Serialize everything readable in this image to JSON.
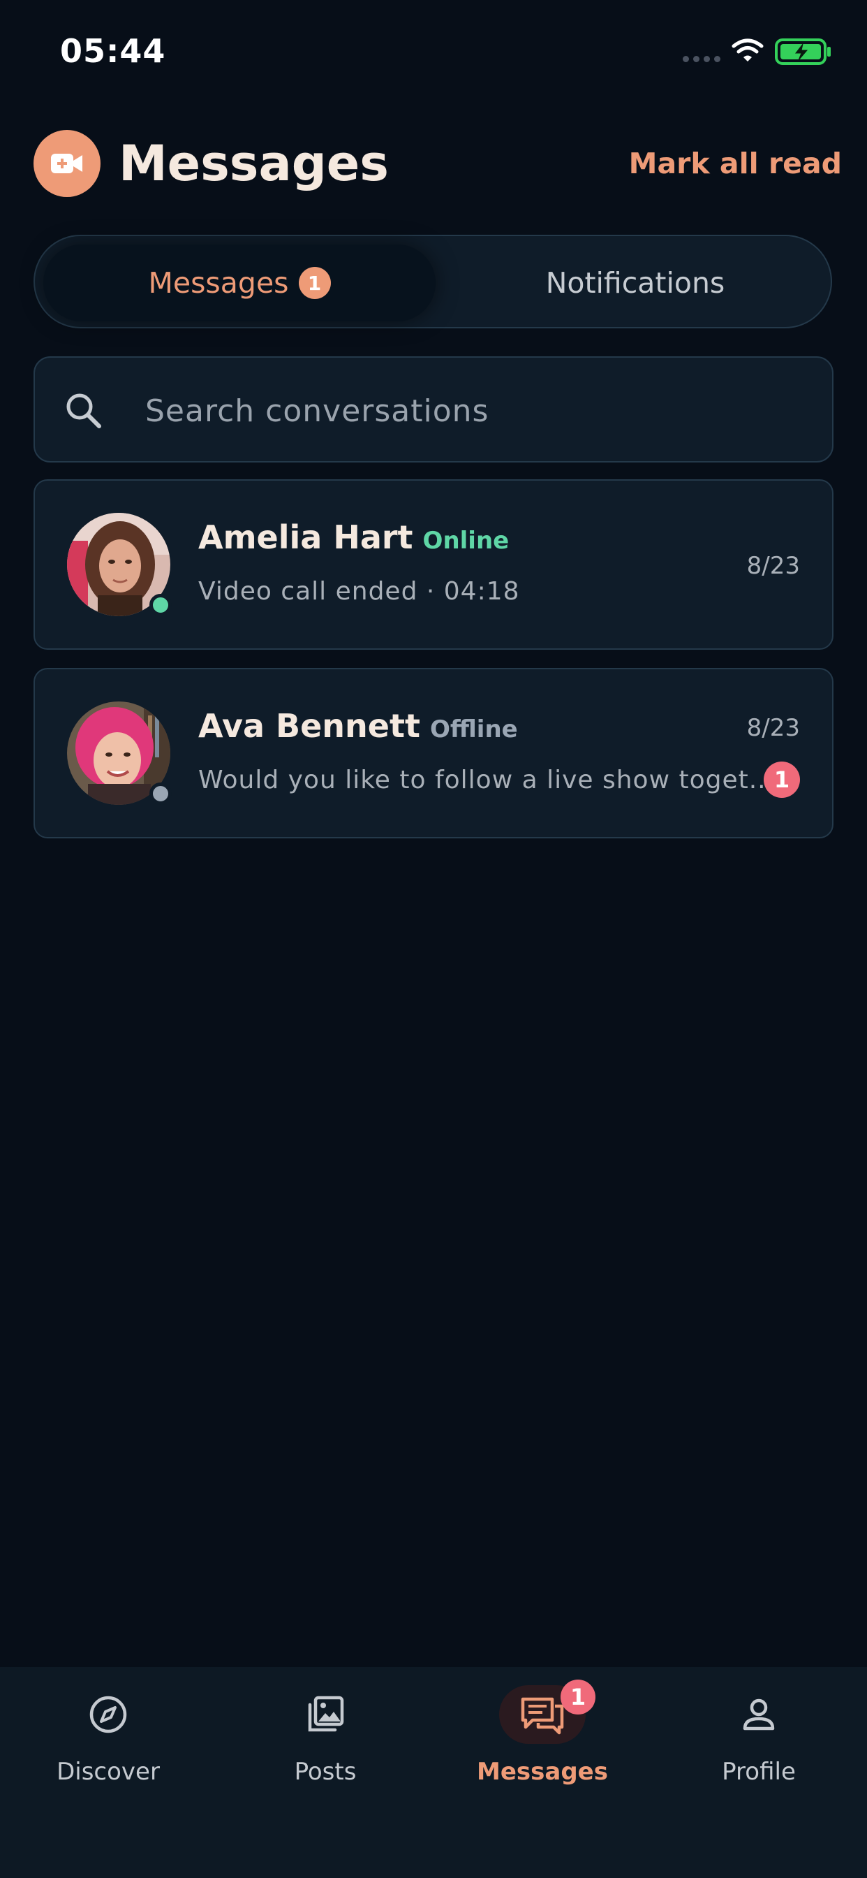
{
  "status_bar": {
    "time": "05:44"
  },
  "header": {
    "title": "Messages",
    "mark_all_read": "Mark all read"
  },
  "tabs": [
    {
      "label": "Messages",
      "badge": "1",
      "active": true
    },
    {
      "label": "Notifications",
      "active": false
    }
  ],
  "search": {
    "placeholder": "Search conversations",
    "value": ""
  },
  "conversations": [
    {
      "name": "Amelia Hart",
      "status": "Online",
      "preview": "Video call ended · 04:18",
      "date": "8/23",
      "unread": ""
    },
    {
      "name": "Ava Bennett",
      "status": "Offline",
      "preview": "Would you like to follow a live show toget...",
      "date": "8/23",
      "unread": "1"
    }
  ],
  "bottom_nav": [
    {
      "label": "Discover",
      "icon": "compass-icon"
    },
    {
      "label": "Posts",
      "icon": "gallery-icon"
    },
    {
      "label": "Messages",
      "icon": "chat-icon",
      "badge": "1",
      "active": true
    },
    {
      "label": "Profile",
      "icon": "person-icon"
    }
  ],
  "colors": {
    "accent": "#ee9b77",
    "online": "#5fd6a6",
    "offline": "#9aa6b4",
    "badge": "#f06a7a",
    "background": "#070e18"
  }
}
